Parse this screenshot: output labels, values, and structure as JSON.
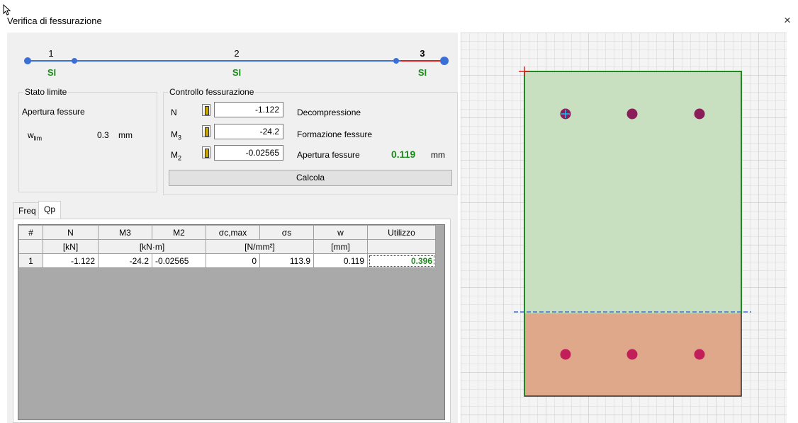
{
  "window": {
    "title": "Verifica di fessurazione",
    "close_label": "×"
  },
  "steps": [
    {
      "number": "1",
      "status": "SI"
    },
    {
      "number": "2",
      "status": "SI"
    },
    {
      "number": "3",
      "status": "SI"
    }
  ],
  "stato_limite": {
    "title": "Stato limite",
    "type": "Apertura fessure",
    "wlim_label": "w",
    "wlim_sub": "lim",
    "wlim_value": "0.3",
    "wlim_unit": "mm"
  },
  "controllo": {
    "title": "Controllo fessurazione",
    "rows": [
      {
        "label": "N",
        "sub": "",
        "value": "-1.122",
        "result_label": "Decompressione"
      },
      {
        "label": "M",
        "sub": "3",
        "value": "-24.2",
        "result_label": "Formazione fessure"
      },
      {
        "label": "M",
        "sub": "2",
        "value": "-0.02565",
        "result_label": "Apertura fessure"
      }
    ],
    "result_value": "0.119",
    "result_unit": "mm",
    "calc_button": "Calcola"
  },
  "tabs": [
    {
      "label": "Freq"
    },
    {
      "label": "Qp"
    }
  ],
  "table": {
    "headers": [
      "#",
      "N",
      "M3",
      "M2",
      "σc,max",
      "σs",
      "w",
      "Utilizzo"
    ],
    "units": [
      "",
      "[kN]",
      "[kN·m]",
      "[N/mm²]",
      "[mm]"
    ],
    "rows": [
      {
        "index": "1",
        "N": "-1.122",
        "M3": "-24.2",
        "M2": "-0.02565",
        "sc": "0",
        "ss": "113.9",
        "w": "0.119",
        "util": "0.396"
      }
    ]
  },
  "colors": {
    "accent_blue": "#3a6fd6",
    "ok_green": "#1d8a1d",
    "step_red": "#e02020",
    "compressed_fill": "#c8e0c0",
    "tension_fill": "#e0a88a",
    "rebar": "#8b1e5a"
  },
  "icons": {
    "cursor": "arrow-cursor-icon",
    "spin": "spin-handle-icon"
  }
}
